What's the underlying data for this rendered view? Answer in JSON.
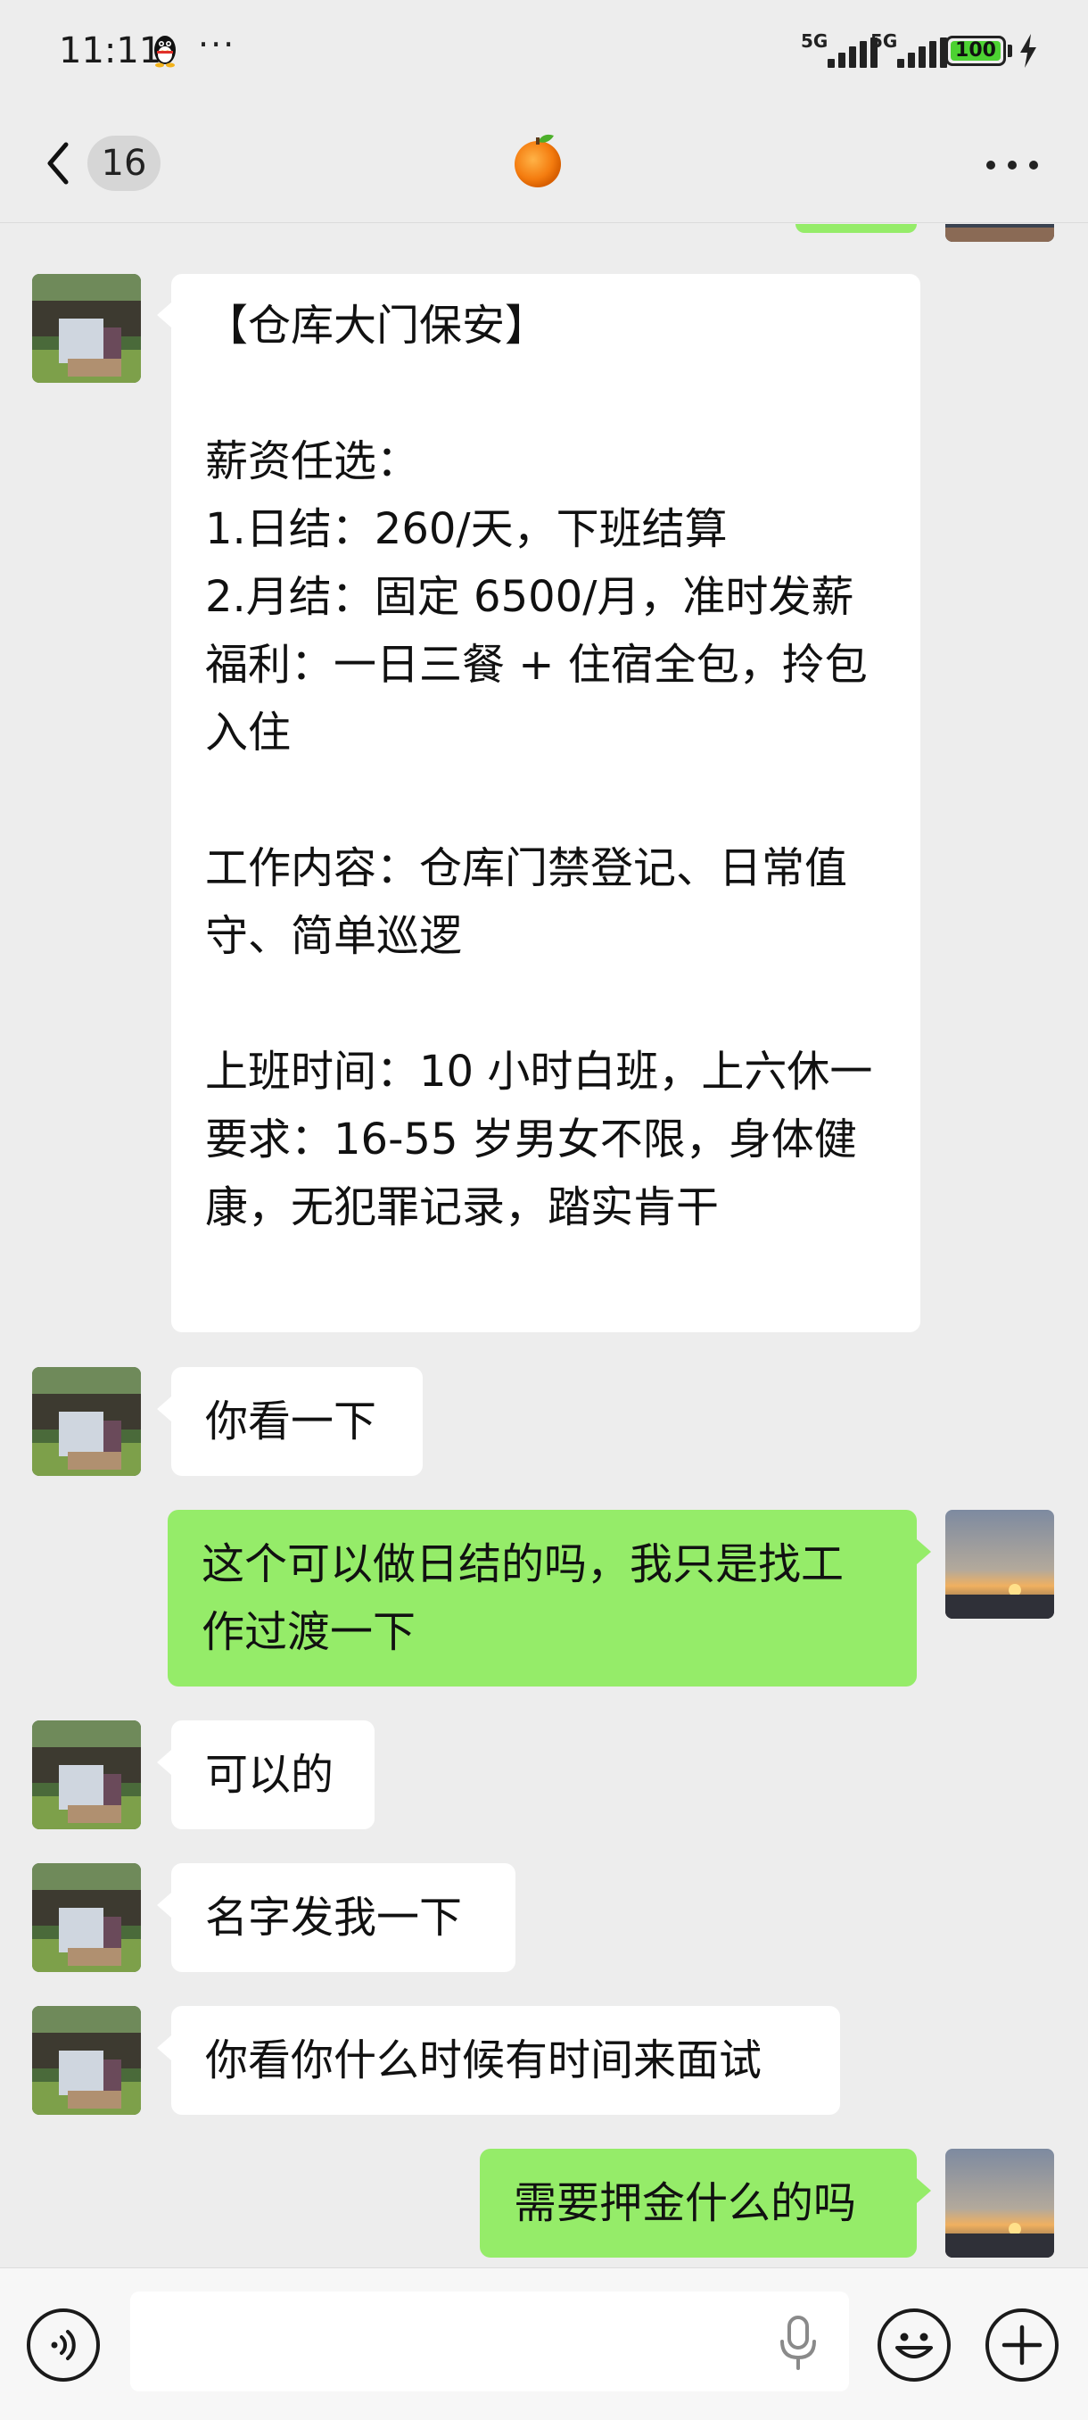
{
  "status_bar": {
    "time": "11:11",
    "more": "···",
    "network1": "5G",
    "network2": "5G",
    "battery": "100"
  },
  "header": {
    "unread_count": "16",
    "title_icon": "orange-emoji-icon",
    "menu_icon": "more-dots-icon"
  },
  "messages": [
    {
      "side": "in",
      "text": "【仓库大门保安】\n\n薪资任选：\n1.日结：260/天，下班结算\n2.月结：固定 6500/月，准时发薪\n福利：一日三餐 + 住宿全包，拎包\n入住\n\n工作内容：仓库门禁登记、日常值\n守、简单巡逻\n\n上班时间：10 小时白班，上六休一\n要求：16-55 岁男女不限，身体健\n康，无犯罪记录，踏实肯干\n"
    },
    {
      "side": "in",
      "text": "你看一下"
    },
    {
      "side": "out",
      "text": "这个可以做日结的吗，我只是找工\n作过渡一下"
    },
    {
      "side": "in",
      "text": "可以的"
    },
    {
      "side": "in",
      "text": "名字发我一下"
    },
    {
      "side": "in",
      "text": "你看你什么时候有时间来面试"
    },
    {
      "side": "out",
      "text": "需要押金什么的吗"
    }
  ],
  "input_bar": {
    "voice_icon": "voice-mode-icon",
    "mic_icon": "microphone-icon",
    "emoji_icon": "emoji-icon",
    "plus_icon": "plus-icon",
    "placeholder": ""
  },
  "colors": {
    "background": "#ededed",
    "incoming_bubble": "#ffffff",
    "outgoing_bubble": "#95ec69",
    "battery_fill": "#4cd232"
  }
}
